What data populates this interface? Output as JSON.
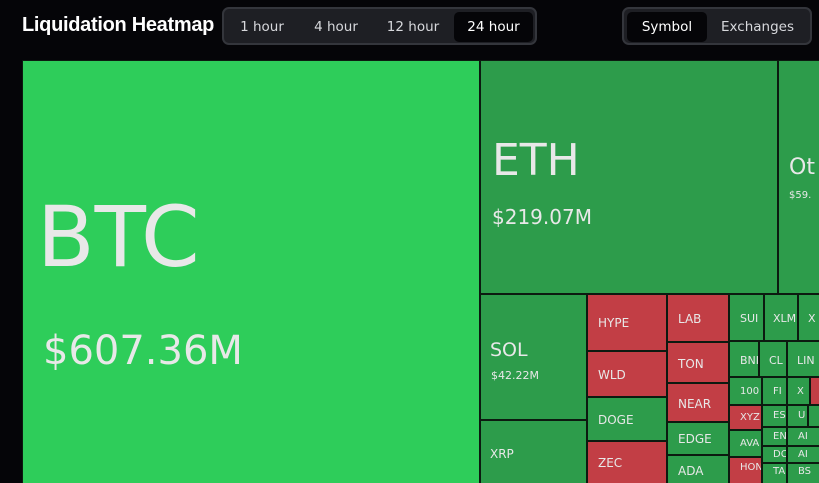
{
  "header": {
    "title": "Liquidation Heatmap",
    "time_ranges": [
      "1 hour",
      "4 hour",
      "12 hour",
      "24 hour"
    ],
    "active_time_range": "24 hour",
    "group_modes": [
      "Symbol",
      "Exchanges"
    ],
    "active_group_mode": "Symbol"
  },
  "colors": {
    "background": "#050508",
    "btc_green": "#2ecd5a",
    "dark_green": "#2d9c4b",
    "red": "#c23e45",
    "label_text": "#e8e8e8"
  },
  "heatmap": {
    "tiles": [
      {
        "symbol": "BTC",
        "value": "$607.36M",
        "trend": "green"
      },
      {
        "symbol": "ETH",
        "value": "$219.07M",
        "trend": "green"
      },
      {
        "symbol": "Ot",
        "value": "$59.",
        "trend": "green"
      },
      {
        "symbol": "SOL",
        "value": "$42.22M",
        "trend": "green"
      },
      {
        "symbol": "XRP",
        "value": "",
        "trend": "green"
      },
      {
        "symbol": "HYPE",
        "trend": "red"
      },
      {
        "symbol": "WLD",
        "trend": "red"
      },
      {
        "symbol": "DOGE",
        "trend": "green"
      },
      {
        "symbol": "ZEC",
        "trend": "red"
      },
      {
        "symbol": "LAB",
        "trend": "red"
      },
      {
        "symbol": "TON",
        "trend": "red"
      },
      {
        "symbol": "NEAR",
        "trend": "red"
      },
      {
        "symbol": "EDGE",
        "trend": "green"
      },
      {
        "symbol": "ADA",
        "trend": "green"
      },
      {
        "symbol": "SUI",
        "trend": "green"
      },
      {
        "symbol": "XLM",
        "trend": "green"
      },
      {
        "symbol": "X",
        "trend": "green"
      },
      {
        "symbol": "BNI",
        "trend": "green"
      },
      {
        "symbol": "CL",
        "trend": "green"
      },
      {
        "symbol": "LIN",
        "trend": "green"
      },
      {
        "symbol": "100",
        "trend": "green"
      },
      {
        "symbol": "FI",
        "trend": "green"
      },
      {
        "symbol": "X",
        "trend": "green"
      },
      {
        "symbol": "XYZ",
        "trend": "red"
      },
      {
        "symbol": "ES",
        "trend": "green"
      },
      {
        "symbol": "U",
        "trend": "green"
      },
      {
        "symbol": "AVA",
        "trend": "green"
      },
      {
        "symbol": "EN",
        "trend": "green"
      },
      {
        "symbol": "AI",
        "trend": "green"
      },
      {
        "symbol": "DC",
        "trend": "green"
      },
      {
        "symbol": "AI",
        "trend": "green"
      },
      {
        "symbol": "HON",
        "trend": "red"
      },
      {
        "symbol": "TA",
        "trend": "green"
      },
      {
        "symbol": "BS",
        "trend": "green"
      }
    ]
  }
}
